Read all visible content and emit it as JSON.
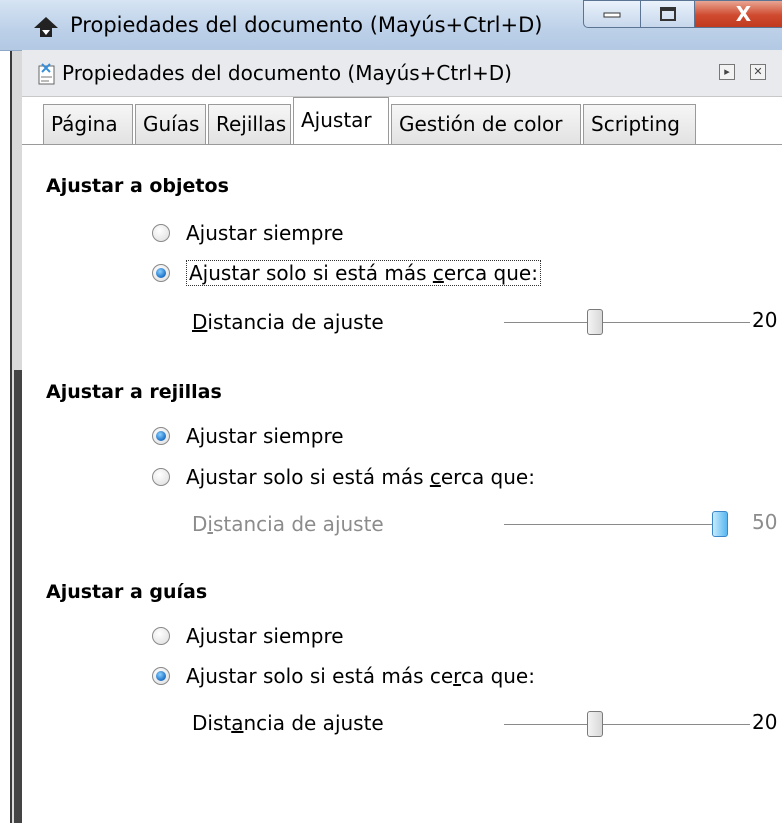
{
  "window": {
    "title": "Propiedades del documento (Mayús+Ctrl+D)",
    "minimize": "—",
    "maximize": "▫",
    "close": "X"
  },
  "panel": {
    "title": "Propiedades del documento (Mayús+Ctrl+D)",
    "menu_btn": "▸",
    "close_btn": "✕"
  },
  "tabs": [
    {
      "label": "Página"
    },
    {
      "label": "Guías"
    },
    {
      "label": "Rejillas"
    },
    {
      "label": "Ajustar"
    },
    {
      "label": "Gestión de color"
    },
    {
      "label": "Scripting"
    }
  ],
  "sections": [
    {
      "title": "Ajustar a objetos",
      "opt_always": "Ajustar siempre",
      "opt_closer_pre": "Ajustar solo si está más ",
      "opt_closer_ul": "c",
      "opt_closer_post": "erca que:",
      "selected": "closer",
      "dist_ul": "D",
      "dist_rest": "istancia de ajuste",
      "value": "20",
      "fraction": 0.37,
      "enabled": true
    },
    {
      "title": "Ajustar a rejillas",
      "opt_always": "Ajustar siempre",
      "opt_closer_pre": "Ajustar solo si está más ",
      "opt_closer_ul": "c",
      "opt_closer_post": "erca que:",
      "selected": "always",
      "dist_pre": "D",
      "dist_ul": "i",
      "dist_post": "stancia de ajuste",
      "value": "50",
      "fraction": 1.0,
      "enabled": false
    },
    {
      "title": "Ajustar a guías",
      "opt_always": "Ajustar siempre",
      "opt_closer_pre": "Ajustar solo si está más ce",
      "opt_closer_ul": "r",
      "opt_closer_post": "ca que:",
      "selected": "closer",
      "dist_pre": "Dist",
      "dist_ul": "a",
      "dist_post": "ncia de ajuste",
      "value": "20",
      "fraction": 0.37,
      "enabled": true
    }
  ]
}
